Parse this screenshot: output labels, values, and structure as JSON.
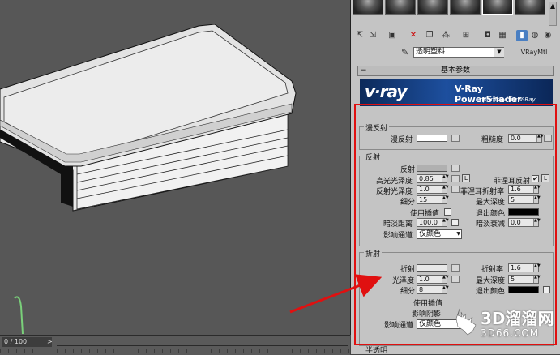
{
  "timeline": {
    "frame": "0 / 100",
    "next": ">"
  },
  "material_editor": {
    "material_name": "透明塑料",
    "material_type": "VRayMtl",
    "rollout_title": "基本参数",
    "banner": {
      "logo": "v·ray",
      "title": "V-Ray PowerShader",
      "subtitle": "optimized for V-Ray"
    }
  },
  "diffuse": {
    "group_title": "漫反射",
    "diffuse_label": "漫反射",
    "roughness_label": "粗糙度",
    "roughness_value": "0.0",
    "diffuse_color": "#ffffff"
  },
  "reflection": {
    "group_title": "反射",
    "reflect_label": "反射",
    "reflect_color": "#b0b0b0",
    "hilight_gloss_label": "高光光泽度",
    "hilight_gloss_value": "0.85",
    "l_button": "L",
    "refl_gloss_label": "反射光泽度",
    "refl_gloss_value": "1.0",
    "subdivs_label": "细分",
    "subdivs_value": "15",
    "use_interp_label": "使用插值",
    "dim_distance_label": "暗淡距离",
    "dim_distance_value": "100.0",
    "affect_channels_label": "影响通道",
    "affect_channels_value": "仅颜色",
    "fresnel_label": "菲涅耳反射",
    "fresnel_checked": "✔",
    "fresnel_ior_label": "菲涅耳折射率",
    "fresnel_ior_value": "1.6",
    "max_depth_label": "最大深度",
    "max_depth_value": "5",
    "exit_color_label": "退出颜色",
    "exit_color": "#000000",
    "dim_falloff_label": "暗淡衰减",
    "dim_falloff_value": "0.0"
  },
  "refraction": {
    "group_title": "折射",
    "refract_label": "折射",
    "refract_color": "#e8e8e8",
    "gloss_label": "光泽度",
    "gloss_value": "1.0",
    "subdivs_label": "细分",
    "subdivs_value": "8",
    "use_interp_label": "使用插值",
    "affect_shadows_label": "影响阴影",
    "affect_channels_label": "影响通道",
    "affect_channels_value": "仅颜色",
    "ior_label": "折射率",
    "ior_value": "1.6",
    "max_depth_label": "最大深度",
    "max_depth_value": "5",
    "exit_color_label": "退出颜色",
    "exit_color": "#000000"
  },
  "next_group": {
    "title": "半透明"
  },
  "watermark": {
    "brand": "3D溜溜网",
    "domain": "3D66.COM"
  },
  "annotation_color": "#e01010",
  "icons": [
    "sphere-swatch",
    "select-by-material-icon",
    "put-to-scene-icon",
    "reset-icon",
    "delete-icon",
    "copy-icon",
    "unique-icon",
    "put-to-library-icon",
    "material-id-icon",
    "show-map-icon",
    "background-icon",
    "show-end-result-icon",
    "go-to-parent-icon",
    "go-forward-icon",
    "eyedropper-icon"
  ]
}
